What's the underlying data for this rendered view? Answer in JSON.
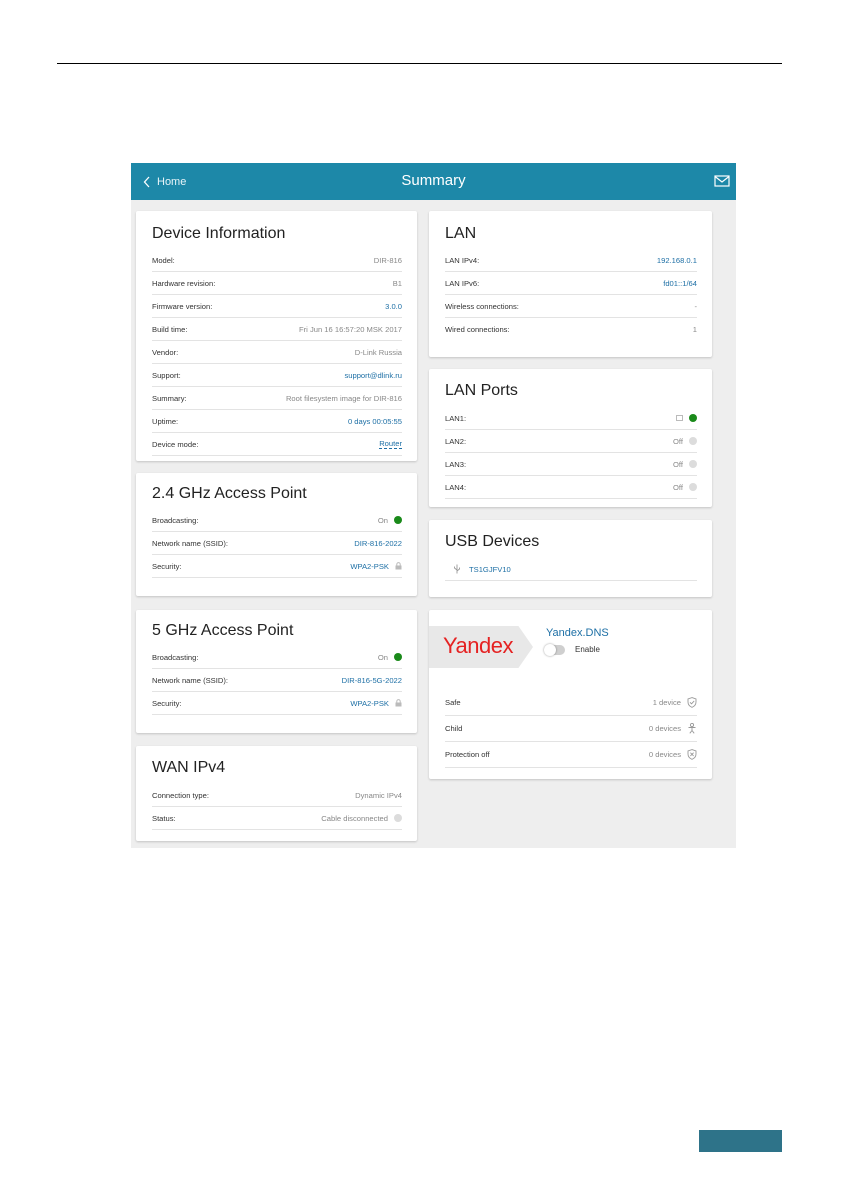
{
  "header": {
    "back_label": "Home",
    "title": "Summary"
  },
  "device_info": {
    "title": "Device Information",
    "rows": [
      {
        "label": "Model:",
        "value": "DIR-816"
      },
      {
        "label": "Hardware revision:",
        "value": "B1"
      },
      {
        "label": "Firmware version:",
        "value": "3.0.0"
      },
      {
        "label": "Build time:",
        "value": "Fri Jun 16 16:57:20 MSK 2017"
      },
      {
        "label": "Vendor:",
        "value": "D-Link Russia"
      },
      {
        "label": "Support:",
        "value": "support@dlink.ru"
      },
      {
        "label": "Summary:",
        "value": "Root filesystem image for DIR-816"
      },
      {
        "label": "Uptime:",
        "value": "0 days 00:05:55"
      },
      {
        "label": "Device mode:",
        "value": "Router"
      }
    ]
  },
  "ap24": {
    "title": "2.4 GHz Access Point",
    "rows": [
      {
        "label": "Broadcasting:",
        "value": "On"
      },
      {
        "label": "Network name (SSID):",
        "value": "DIR-816-2022"
      },
      {
        "label": "Security:",
        "value": "WPA2-PSK"
      }
    ]
  },
  "ap5": {
    "title": "5 GHz Access Point",
    "rows": [
      {
        "label": "Broadcasting:",
        "value": "On"
      },
      {
        "label": "Network name (SSID):",
        "value": "DIR-816-5G-2022"
      },
      {
        "label": "Security:",
        "value": "WPA2-PSK"
      }
    ]
  },
  "wan": {
    "title": "WAN IPv4",
    "rows": [
      {
        "label": "Connection type:",
        "value": "Dynamic IPv4"
      },
      {
        "label": "Status:",
        "value": "Cable disconnected"
      }
    ]
  },
  "lan": {
    "title": "LAN",
    "rows": [
      {
        "label": "LAN IPv4:",
        "value": "192.168.0.1"
      },
      {
        "label": "LAN IPv6:",
        "value": "fd01::1/64"
      },
      {
        "label": "Wireless connections:",
        "value": "-"
      },
      {
        "label": "Wired connections:",
        "value": "1"
      }
    ]
  },
  "lan_ports": {
    "title": "LAN Ports",
    "rows": [
      {
        "label": "LAN1:",
        "value": "",
        "status": "on"
      },
      {
        "label": "LAN2:",
        "value": "Off",
        "status": "off"
      },
      {
        "label": "LAN3:",
        "value": "Off",
        "status": "off"
      },
      {
        "label": "LAN4:",
        "value": "Off",
        "status": "off"
      }
    ]
  },
  "usb": {
    "title": "USB Devices",
    "device": "TS1GJFV10"
  },
  "yandex": {
    "logo_text": "Yandex",
    "title": "Yandex.DNS",
    "enable_label": "Enable",
    "enabled": false,
    "rows": [
      {
        "label": "Safe",
        "value": "1 device",
        "icon": "shield-check-icon"
      },
      {
        "label": "Child",
        "value": "0 devices",
        "icon": "child-icon"
      },
      {
        "label": "Protection off",
        "value": "0 devices",
        "icon": "shield-x-icon"
      }
    ]
  },
  "colors": {
    "header": "#1d88a8",
    "link": "#1d6fa5",
    "status_on": "#1a8a1a",
    "status_off": "#dcdcdc",
    "yandex_red": "#e52222"
  }
}
